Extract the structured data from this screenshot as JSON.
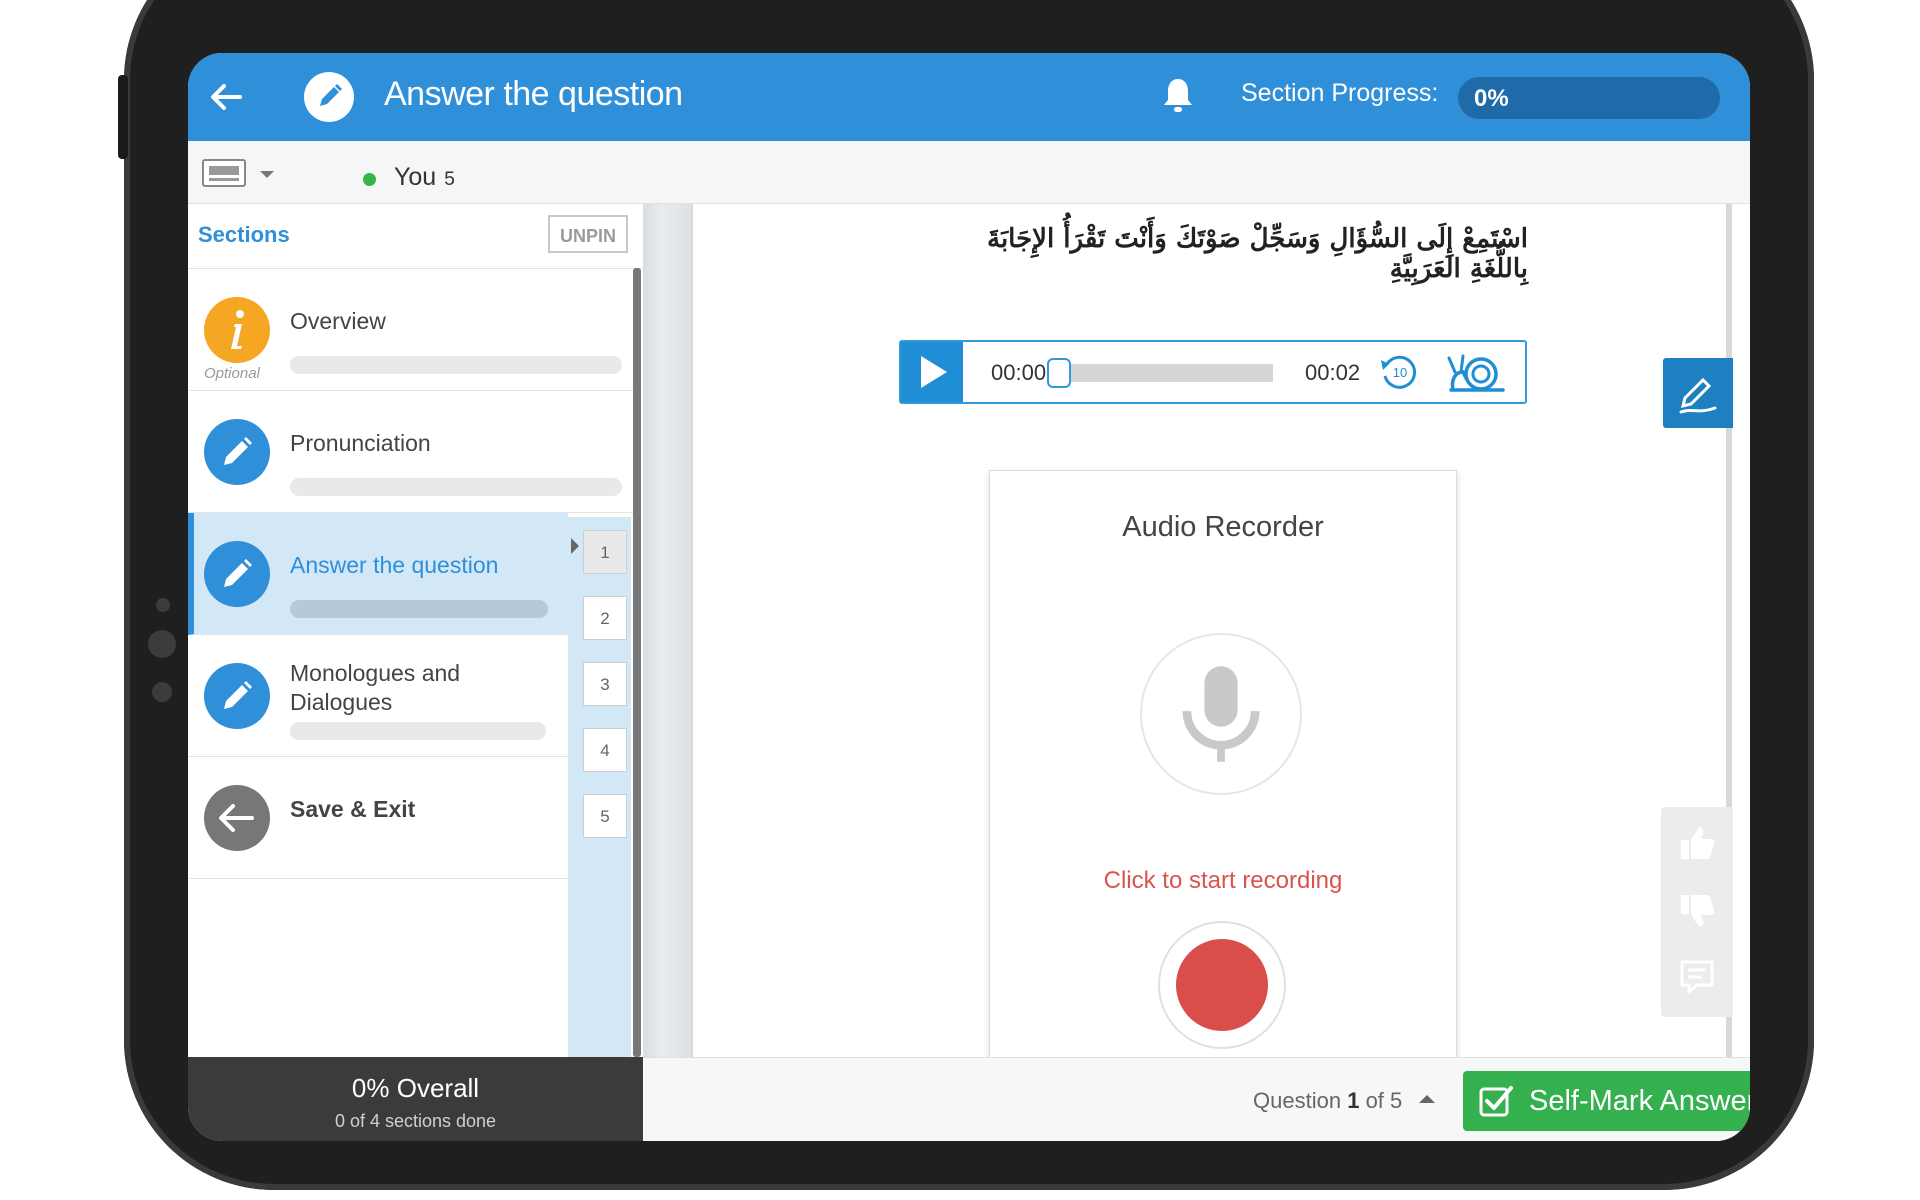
{
  "header": {
    "title": "Answer the question",
    "progress_label": "Section Progress:",
    "progress_value": "0%",
    "progress_fraction": 0
  },
  "subbar": {
    "user_name": "You",
    "user_count": "5"
  },
  "sidebar": {
    "title": "Sections",
    "unpin_label": "UNPIN",
    "items": [
      {
        "label": "Overview",
        "icon": "info-icon",
        "note": "Optional",
        "color": "#f5a623"
      },
      {
        "label": "Pronunciation",
        "icon": "pencil-icon",
        "color": "#2f8fd8"
      },
      {
        "label": "Answer the question",
        "icon": "pencil-icon",
        "color": "#2f8fd8",
        "active": true
      },
      {
        "label": "Monologues and Dialogues",
        "icon": "pencil-icon",
        "color": "#2f8fd8"
      },
      {
        "label": "Save & Exit",
        "icon": "arrow-left-icon",
        "color": "#777777"
      }
    ],
    "questions": [
      "1",
      "2",
      "3",
      "4",
      "5"
    ]
  },
  "main": {
    "instruction": "اسْتَمِعْ إِلَى السُّؤَالِ وَسَجِّلْ صَوْتَكَ وَأَنْتَ تَقْرَأُ الإِجَابَةَ بِاللُّغَةِ العَرَبِيَّةِ",
    "audio": {
      "current_time": "00:00",
      "duration": "00:02",
      "rewind_seconds": "10"
    },
    "recorder": {
      "title": "Audio Recorder",
      "hint": "Click to start recording"
    }
  },
  "footer": {
    "overall": "0% Overall",
    "overall_sub": "0 of 4 sections done",
    "question_prefix": "Question",
    "question_current": "1",
    "question_suffix": "of 5",
    "self_mark_label": "Self-Mark Answer"
  },
  "colors": {
    "brand_blue": "#2f8fd8",
    "record_red": "#d94d4a",
    "success_green": "#34b04f"
  }
}
